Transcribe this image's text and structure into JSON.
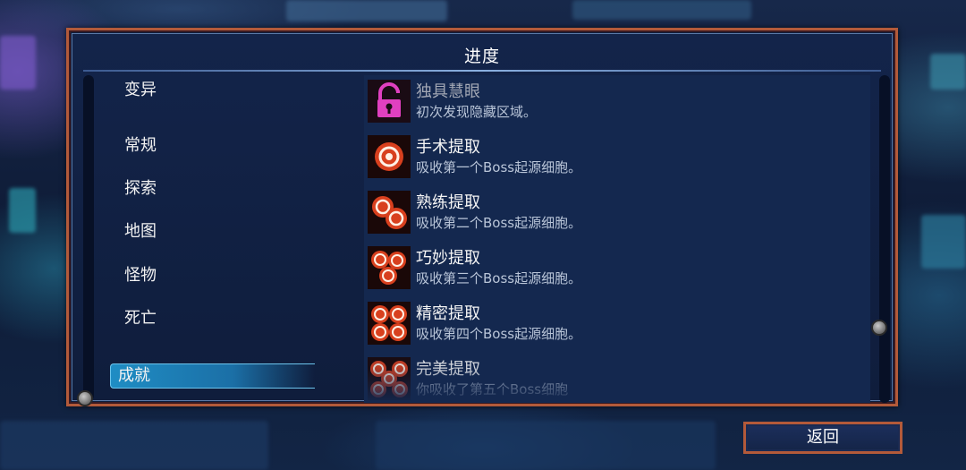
{
  "panel": {
    "title": "进度"
  },
  "menu": {
    "items": [
      {
        "label": "变异",
        "active": false
      },
      {
        "label": "常规",
        "active": false
      },
      {
        "label": "探索",
        "active": false
      },
      {
        "label": "地图",
        "active": false
      },
      {
        "label": "怪物",
        "active": false
      },
      {
        "label": "死亡",
        "active": false
      },
      {
        "label": "成就",
        "active": true
      }
    ]
  },
  "achievements": [
    {
      "name": "独具慧眼",
      "desc": "初次发现隐藏区域。",
      "icon": "padlock-icon",
      "locked": true
    },
    {
      "name": "手术提取",
      "desc": "吸收第一个Boss起源细胞。",
      "icon": "boss-cell-1-icon"
    },
    {
      "name": "熟练提取",
      "desc": "吸收第二个Boss起源细胞。",
      "icon": "boss-cell-2-icon"
    },
    {
      "name": "巧妙提取",
      "desc": "吸收第三个Boss起源细胞。",
      "icon": "boss-cell-3-icon"
    },
    {
      "name": "精密提取",
      "desc": "吸收第四个Boss起源细胞。",
      "icon": "boss-cell-4-icon"
    },
    {
      "name": "完美提取",
      "desc": "你吸收了第五个Boss细胞",
      "icon": "boss-cell-5-icon"
    }
  ],
  "back_button": {
    "label": "返回"
  },
  "colors": {
    "frame": "#b35a3a",
    "active_tab": "#1f8dc4",
    "lock": "#e040c0",
    "cell": "#d8401e"
  }
}
